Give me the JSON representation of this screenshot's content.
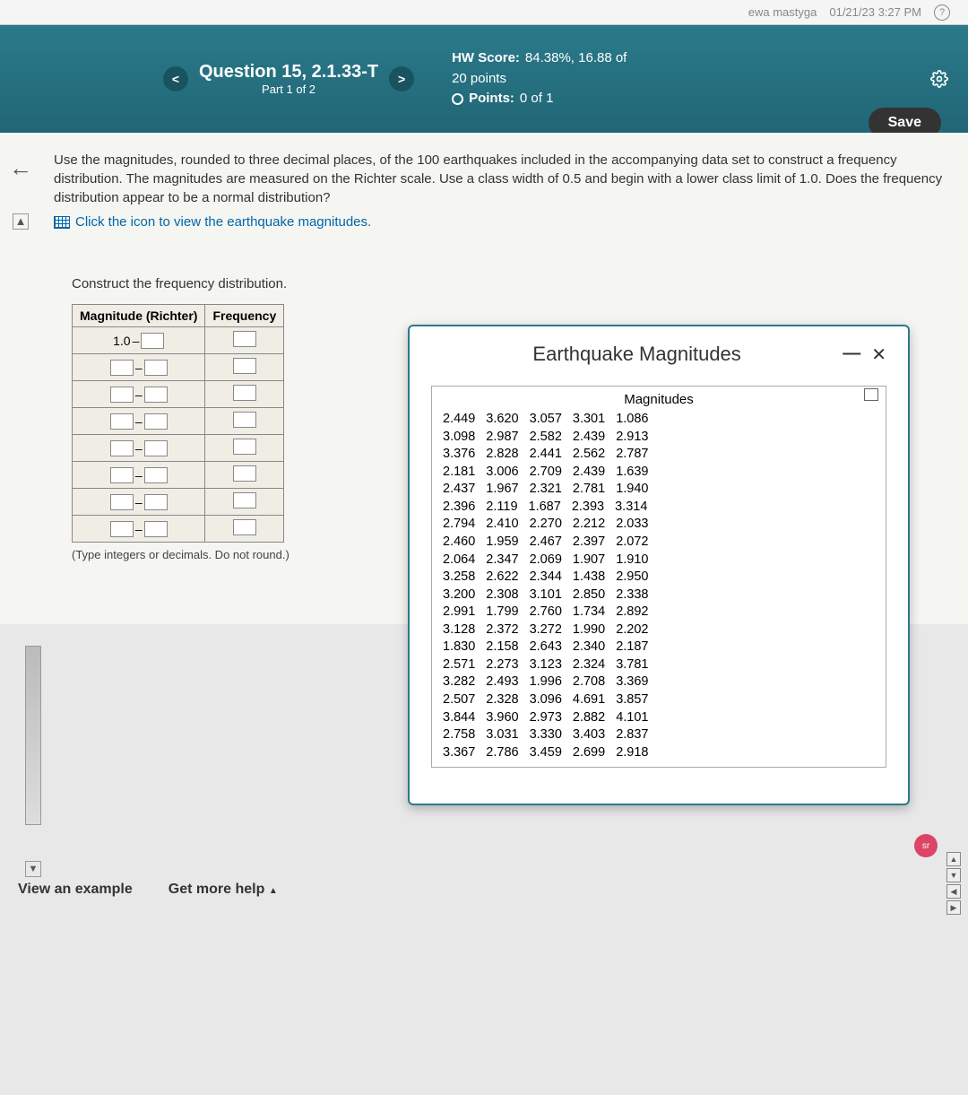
{
  "top": {
    "user": "ewa mastyga",
    "datetime": "01/21/23 3:27 PM"
  },
  "nav": {
    "prev": "<",
    "next": ">",
    "question_title": "Question 15, 2.1.33-T",
    "part": "Part 1 of 2",
    "hw_score_label": "HW Score:",
    "hw_score_value": "84.38%, 16.88 of",
    "hw_score_line2": "20 points",
    "points_label": "Points:",
    "points_value": "0 of 1",
    "save": "Save"
  },
  "instructions": {
    "text": "Use the magnitudes, rounded to three decimal places, of the 100 earthquakes included in the accompanying data set to construct a frequency distribution. The magnitudes are measured on the Richter scale. Use a class width of 0.5 and begin with a lower class limit of 1.0. Does the frequency distribution appear to be a normal distribution?",
    "link": "Click the icon to view the earthquake magnitudes."
  },
  "freq": {
    "title": "Construct the frequency distribution.",
    "col1": "Magnitude (Richter)",
    "col2": "Frequency",
    "first_lower": "1.0",
    "note": "(Type integers or decimals. Do not round.)"
  },
  "popup": {
    "title": "Earthquake Magnitudes",
    "table_caption": "Magnitudes",
    "rows": [
      [
        "2.449",
        "3.620",
        "3.057",
        "3.301",
        "1.086"
      ],
      [
        "3.098",
        "2.987",
        "2.582",
        "2.439",
        "2.913"
      ],
      [
        "3.376",
        "2.828",
        "2.441",
        "2.562",
        "2.787"
      ],
      [
        "2.181",
        "3.006",
        "2.709",
        "2.439",
        "1.639"
      ],
      [
        "2.437",
        "1.967",
        "2.321",
        "2.781",
        "1.940"
      ],
      [
        "2.396",
        "2.119",
        "1.687",
        "2.393",
        "3.314"
      ],
      [
        "2.794",
        "2.410",
        "2.270",
        "2.212",
        "2.033"
      ],
      [
        "2.460",
        "1.959",
        "2.467",
        "2.397",
        "2.072"
      ],
      [
        "2.064",
        "2.347",
        "2.069",
        "1.907",
        "1.910"
      ],
      [
        "3.258",
        "2.622",
        "2.344",
        "1.438",
        "2.950"
      ],
      [
        "3.200",
        "2.308",
        "3.101",
        "2.850",
        "2.338"
      ],
      [
        "2.991",
        "1.799",
        "2.760",
        "1.734",
        "2.892"
      ],
      [
        "3.128",
        "2.372",
        "3.272",
        "1.990",
        "2.202"
      ],
      [
        "1.830",
        "2.158",
        "2.643",
        "2.340",
        "2.187"
      ],
      [
        "2.571",
        "2.273",
        "3.123",
        "2.324",
        "3.781"
      ],
      [
        "3.282",
        "2.493",
        "1.996",
        "2.708",
        "3.369"
      ],
      [
        "2.507",
        "2.328",
        "3.096",
        "4.691",
        "3.857"
      ],
      [
        "3.844",
        "3.960",
        "2.973",
        "2.882",
        "4.101"
      ],
      [
        "2.758",
        "3.031",
        "3.330",
        "3.403",
        "2.837"
      ],
      [
        "3.367",
        "2.786",
        "3.459",
        "2.699",
        "2.918"
      ]
    ]
  },
  "bottom": {
    "view_example": "View an example",
    "get_help": "Get more help"
  }
}
